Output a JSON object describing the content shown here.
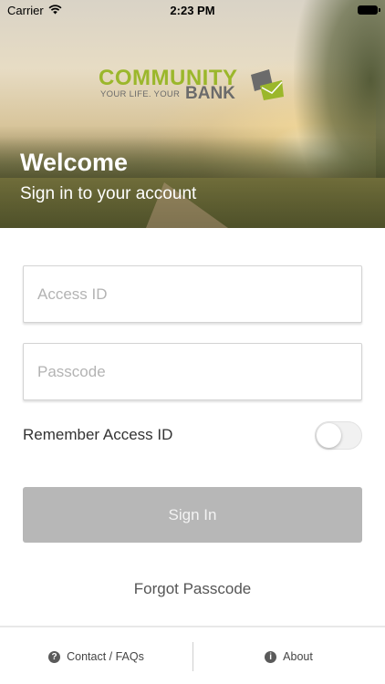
{
  "status_bar": {
    "carrier": "Carrier",
    "time": "2:23 PM"
  },
  "logo": {
    "line1": "COMMUNITY",
    "tagline": "YOUR LIFE. YOUR",
    "line2": "BANK",
    "brand_green": "#9bb72b",
    "brand_gray": "#6b6b6b"
  },
  "hero": {
    "title": "Welcome",
    "subtitle": "Sign in to your account"
  },
  "form": {
    "access_id": {
      "value": "",
      "placeholder": "Access ID"
    },
    "passcode": {
      "value": "",
      "placeholder": "Passcode"
    },
    "remember_label": "Remember Access ID",
    "remember_enabled": false,
    "sign_in_label": "Sign In",
    "forgot_label": "Forgot Passcode"
  },
  "bottom_nav": {
    "contact_label": "Contact / FAQs",
    "contact_icon": "question-circle-icon",
    "about_label": "About",
    "about_icon": "info-circle-icon"
  }
}
